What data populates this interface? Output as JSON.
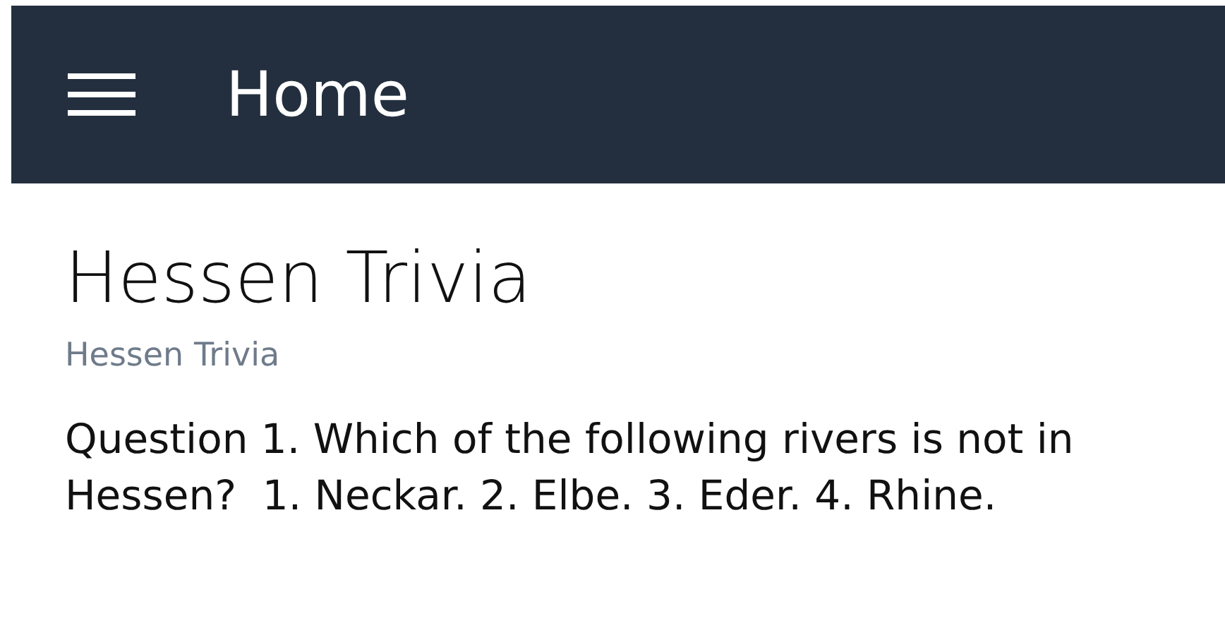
{
  "header": {
    "title": "Home"
  },
  "card": {
    "title": "Hessen Trivia",
    "subtitle": "Hessen Trivia",
    "body": "Question 1. Which of the following rivers is not in Hessen?  1. Neckar. 2. Elbe. 3. Eder. 4. Rhine."
  }
}
